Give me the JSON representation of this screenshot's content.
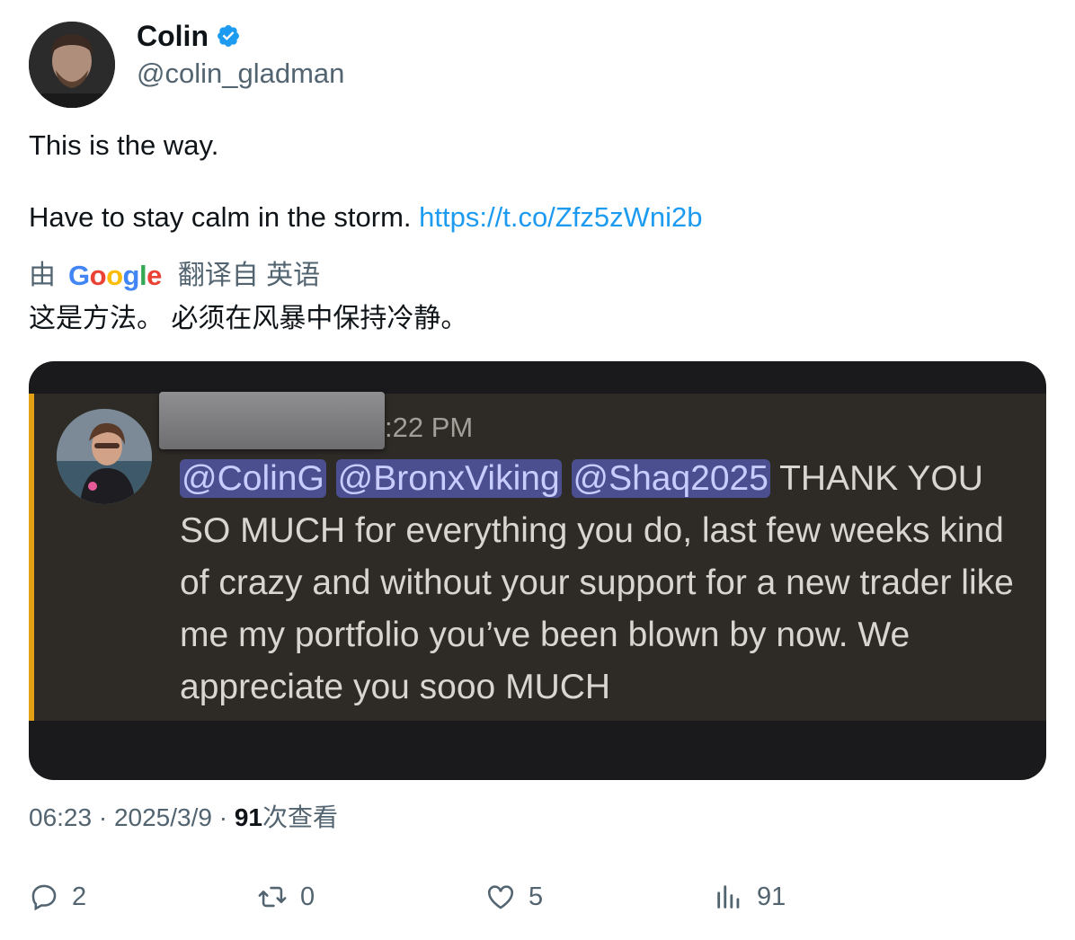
{
  "author": {
    "name": "Colin",
    "handle": "@colin_gladman",
    "verified": true
  },
  "tweet": {
    "line1": "This is the way.",
    "line2_text": "Have to stay calm in the storm.",
    "link": "https://t.co/Zfz5zWni2b"
  },
  "translation": {
    "by": "由",
    "provider": "Google",
    "from": "翻译自 英语",
    "text": "这是方法。 必须在风暴中保持冷静。"
  },
  "media": {
    "time": ":22 PM",
    "mentions": [
      "@ColinG",
      "@BronxViking",
      "@Shaq2025"
    ],
    "message": "THANK YOU SO MUCH for everything you do, last few weeks kind of crazy and without your support for a new trader like me my portfolio you’ve been blown by now. We appreciate you sooo MUCH"
  },
  "meta": {
    "time": "06:23",
    "sep1": "·",
    "date": "2025/3/9",
    "sep2": "·",
    "views_count": "91",
    "views_label": "次查看"
  },
  "actions": {
    "replies": "2",
    "reposts": "0",
    "likes": "5",
    "views": "91"
  },
  "colors": {
    "accent_link": "#1d9bf0",
    "muted": "#536471",
    "verified_badge": "#1d9bf0",
    "media_accent_bar": "#e2a114",
    "mention_bg": "#4b4f8f"
  }
}
